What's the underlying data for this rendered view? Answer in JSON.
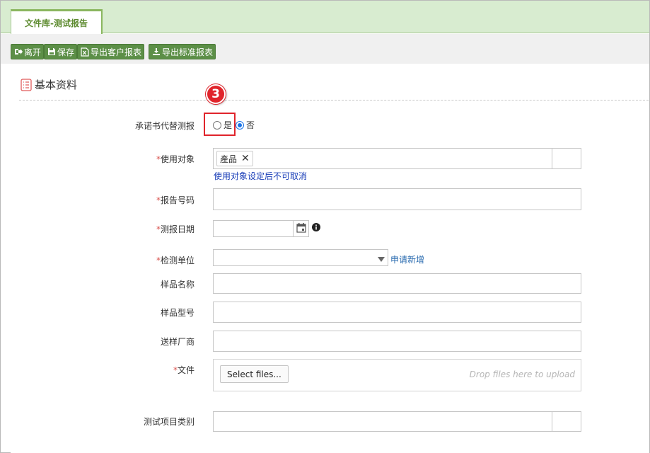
{
  "tab": {
    "label": "文件库-测试报告"
  },
  "toolbar": {
    "leave": "离开",
    "save": "保存",
    "export_customer": "导出客户报表",
    "export_standard": "导出标准报表"
  },
  "section": {
    "title": "基本资料"
  },
  "annotation": {
    "step": "3"
  },
  "form": {
    "commitment": {
      "label": "承诺书代替测报",
      "yes": "是",
      "no": "否"
    },
    "target": {
      "label": "使用对象",
      "tag": "產品",
      "remove": "✕",
      "hint": "使用对象设定后不可取消"
    },
    "report_no": {
      "label": "报告号码",
      "value": ""
    },
    "test_date": {
      "label": "测报日期",
      "value": ""
    },
    "lab": {
      "label": "检测单位",
      "value": "",
      "apply_link": "申请新增"
    },
    "sample_name": {
      "label": "样品名称",
      "value": ""
    },
    "sample_model": {
      "label": "样品型号",
      "value": ""
    },
    "vendor": {
      "label": "送样厂商",
      "value": ""
    },
    "file": {
      "label": "文件",
      "select_label": "Select files...",
      "drop_hint": "Drop files here to upload"
    },
    "test_category": {
      "label": "测试项目类别",
      "value": ""
    }
  },
  "colors": {
    "accent": "#5c8f47",
    "required": "#d9534f",
    "link": "#2b6cb0",
    "highlight": "#e0242b"
  }
}
